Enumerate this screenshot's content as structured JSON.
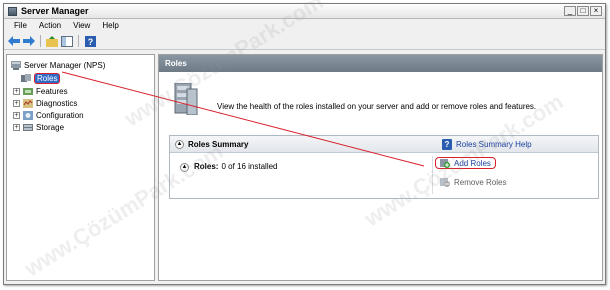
{
  "window": {
    "title": "Server Manager",
    "controls": [
      "_",
      "□",
      "×"
    ]
  },
  "menu": [
    "File",
    "Action",
    "View",
    "Help"
  ],
  "toolbar": {
    "icons": [
      "back-arrow-icon",
      "forward-arrow-icon",
      "up-folder-icon",
      "show-hide-tree-icon",
      "help-icon"
    ]
  },
  "tree": {
    "root": "Server Manager (NPS)",
    "items": [
      {
        "label": "Roles",
        "expanded": false,
        "selected": true
      },
      {
        "label": "Features",
        "expanded": false
      },
      {
        "label": "Diagnostics",
        "expanded": false
      },
      {
        "label": "Configuration",
        "expanded": false
      },
      {
        "label": "Storage",
        "expanded": false
      }
    ]
  },
  "content": {
    "header": "Roles",
    "intro": "View the health of the roles installed on your server and add or remove roles and features.",
    "summary": {
      "title": "Roles Summary",
      "help_link": "Roles Summary Help",
      "roles_label": "Roles:",
      "roles_value": "0 of 16 installed",
      "add_roles": "Add Roles",
      "remove_roles": "Remove Roles"
    }
  },
  "colors": {
    "highlight_red": "#d81f2b",
    "selection_blue": "#316ac5",
    "header_gray": "#7a8692"
  },
  "watermark": "www.ÇözümPark.com"
}
